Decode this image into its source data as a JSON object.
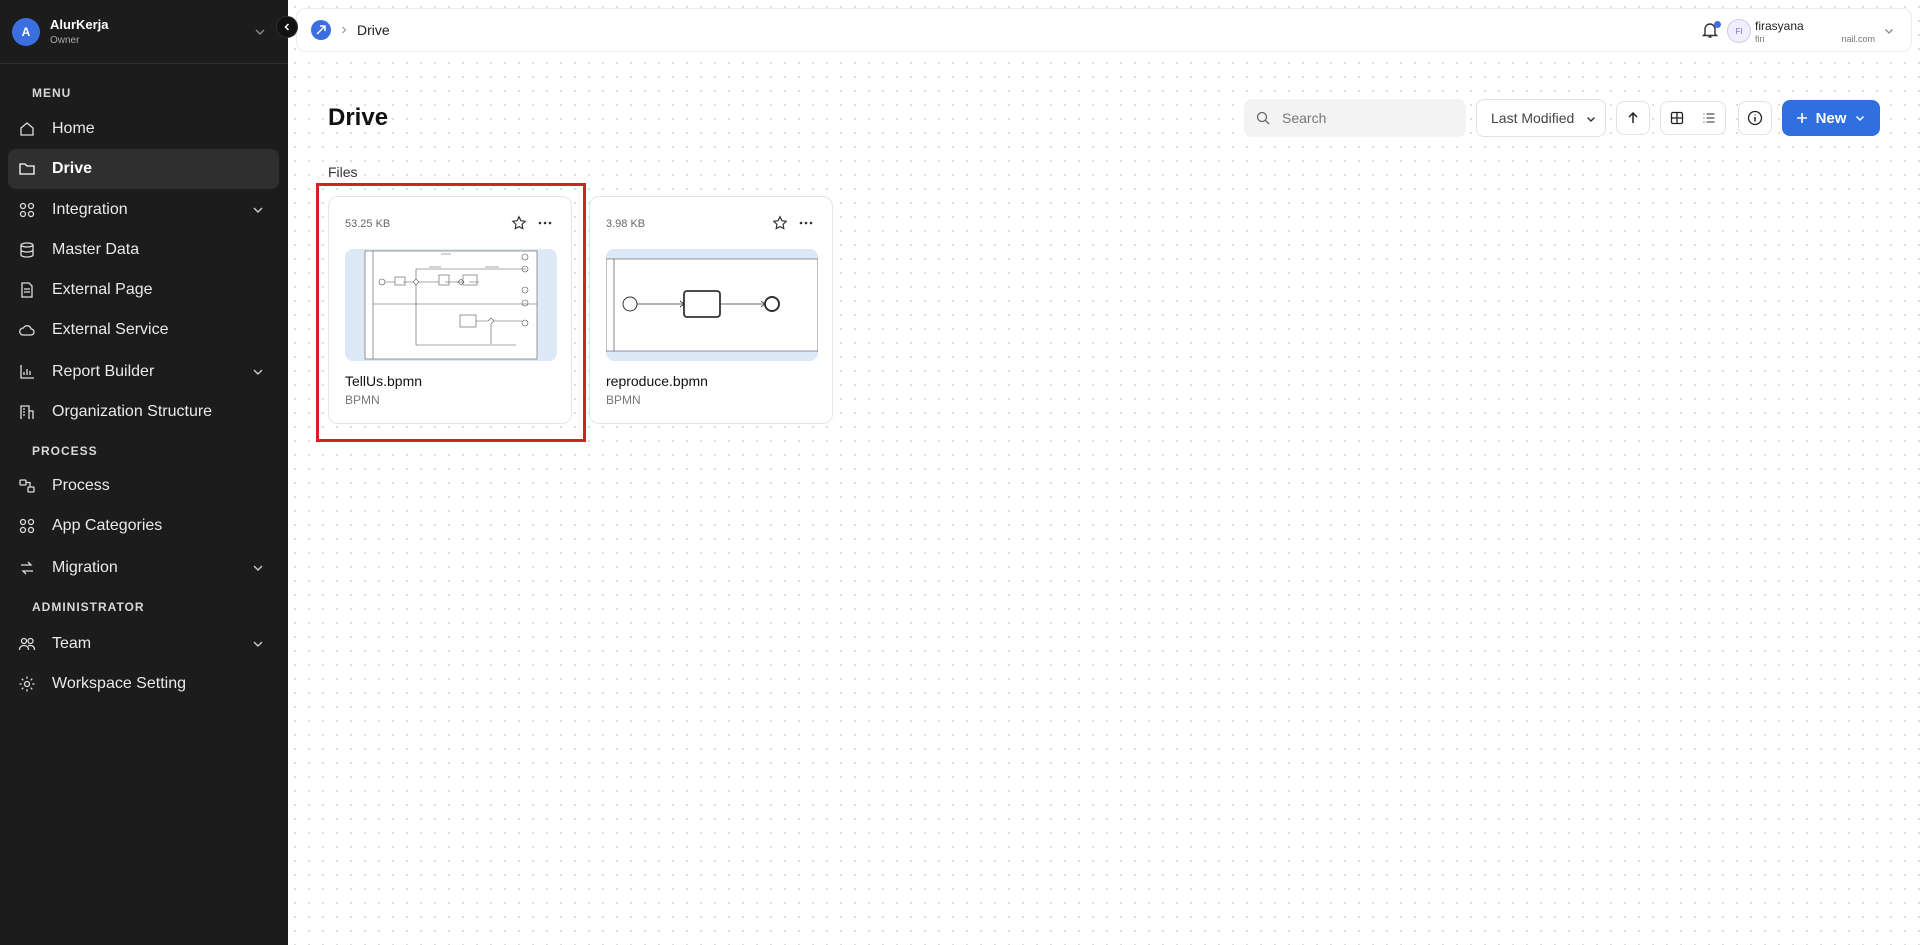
{
  "workspace": {
    "avatar_letter": "A",
    "name": "AlurKerja",
    "role": "Owner"
  },
  "sidebar": {
    "sections": {
      "menu": "MENU",
      "process": "PROCESS",
      "administrator": "ADMINISTRATOR"
    },
    "items": [
      {
        "label": "Home",
        "icon": "home-icon"
      },
      {
        "label": "Drive",
        "icon": "folder-icon",
        "active": true
      },
      {
        "label": "Integration",
        "icon": "grid-icon",
        "expandable": true
      },
      {
        "label": "Master Data",
        "icon": "database-icon"
      },
      {
        "label": "External Page",
        "icon": "page-icon"
      },
      {
        "label": "External Service",
        "icon": "cloud-icon"
      },
      {
        "label": "Report Builder",
        "icon": "chart-icon",
        "expandable": true
      },
      {
        "label": "Organization Structure",
        "icon": "building-icon"
      },
      {
        "label": "Process",
        "icon": "process-icon"
      },
      {
        "label": "App Categories",
        "icon": "grid-icon"
      },
      {
        "label": "Migration",
        "icon": "migration-icon",
        "expandable": true
      },
      {
        "label": "Team",
        "icon": "team-icon",
        "expandable": true
      },
      {
        "label": "Workspace Setting",
        "icon": "gear-icon"
      }
    ]
  },
  "topbar": {
    "breadcrumb": "Drive",
    "user": {
      "initials": "FI",
      "name": "firasyana",
      "email_start": "firi",
      "email_end": "nail.com"
    }
  },
  "page": {
    "title": "Drive",
    "search_placeholder": "Search",
    "sort_value": "Last Modified",
    "new_label": "New",
    "files_label": "Files"
  },
  "files": [
    {
      "name": "TellUs.bpmn",
      "type": "BPMN",
      "size": "53.25 KB",
      "selected": true
    },
    {
      "name": "reproduce.bpmn",
      "type": "BPMN",
      "size": "3.98 KB"
    }
  ],
  "colors": {
    "sidebar_bg": "#1c1c1c",
    "accent": "#2f6fe0",
    "highlight": "#d81f26"
  }
}
